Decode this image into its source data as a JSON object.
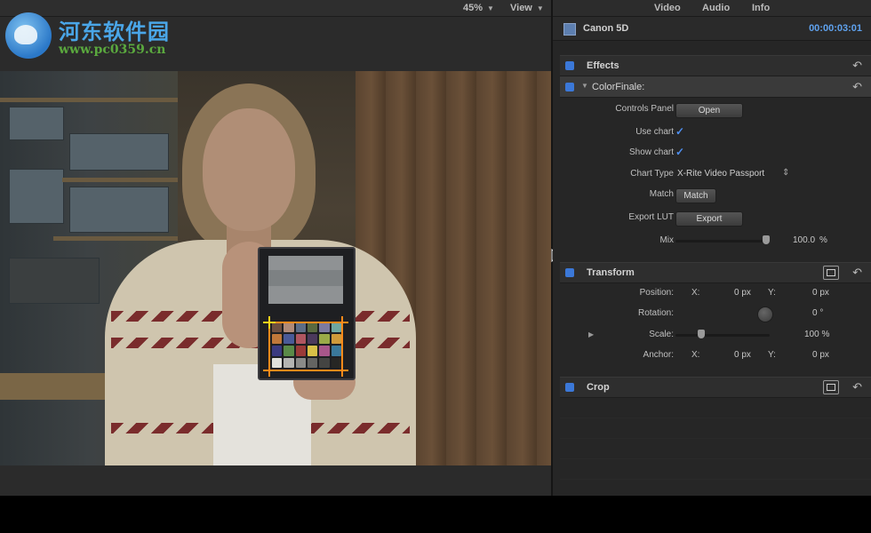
{
  "viewer": {
    "zoom": "45%",
    "view_label": "View"
  },
  "watermark": {
    "site_name": "河东软件园",
    "url": "www.pc0359.cn"
  },
  "inspector": {
    "tabs": [
      "Video",
      "Audio",
      "Info"
    ],
    "active_tab": "Video",
    "clip_name": "Canon 5D",
    "timecode": "00:00:03:01",
    "effects": {
      "title": "Effects",
      "plugin": {
        "title": "ColorFinale:",
        "controls_panel_label": "Controls Panel",
        "open_button": "Open",
        "use_chart_label": "Use chart",
        "use_chart_checked": true,
        "show_chart_label": "Show chart",
        "show_chart_checked": true,
        "chart_type_label": "Chart Type",
        "chart_type_value": "X-Rite Video Passport",
        "match_label": "Match",
        "match_button": "Match",
        "export_lut_label": "Export LUT",
        "export_button": "Export",
        "mix_label": "Mix",
        "mix_value": "100.0",
        "mix_unit": "%",
        "mix_fraction": 1.0
      }
    },
    "transform": {
      "title": "Transform",
      "position_label": "Position:",
      "x_label": "X:",
      "y_label": "Y:",
      "position_x": "0 px",
      "position_y": "0 px",
      "rotation_label": "Rotation:",
      "rotation_value": "0 °",
      "scale_label": "Scale:",
      "scale_value": "100 %",
      "scale_fraction": 0.25,
      "anchor_label": "Anchor:",
      "anchor_x": "0 px",
      "anchor_y": "0 px"
    },
    "crop": {
      "title": "Crop"
    }
  },
  "colors": {
    "accent_blue": "#3b78d8",
    "timecode": "#5fa2ee",
    "chart_marker": "#ff8a1a",
    "chart_marker_selected": "#ffd21a"
  }
}
